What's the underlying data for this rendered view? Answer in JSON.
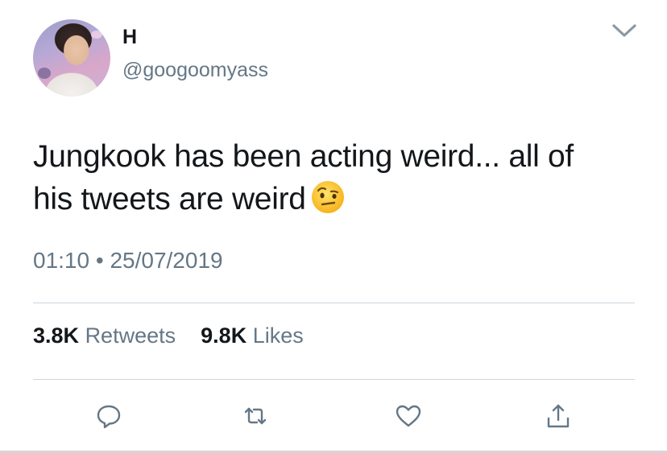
{
  "user": {
    "display_name": "H",
    "handle": "@googoomyass",
    "avatar": "profile-photo"
  },
  "tweet": {
    "text_line1": "Jungkook has been acting weird... all of",
    "text_line2": "his tweets are weird",
    "emoji": "face-with-raised-eyebrow",
    "time": "01:10",
    "separator": "•",
    "date": "25/07/2019"
  },
  "stats": {
    "retweets_count": "3.8K",
    "retweets_label": "Retweets",
    "likes_count": "9.8K",
    "likes_label": "Likes"
  },
  "icons": {
    "menu": "chevron-down-icon",
    "reply": "reply-icon",
    "retweet": "retweet-icon",
    "like": "heart-icon",
    "share": "share-icon"
  },
  "colors": {
    "text": "#14171a",
    "secondary": "#657786",
    "divider": "#ccd6dd",
    "icon": "#657786"
  }
}
